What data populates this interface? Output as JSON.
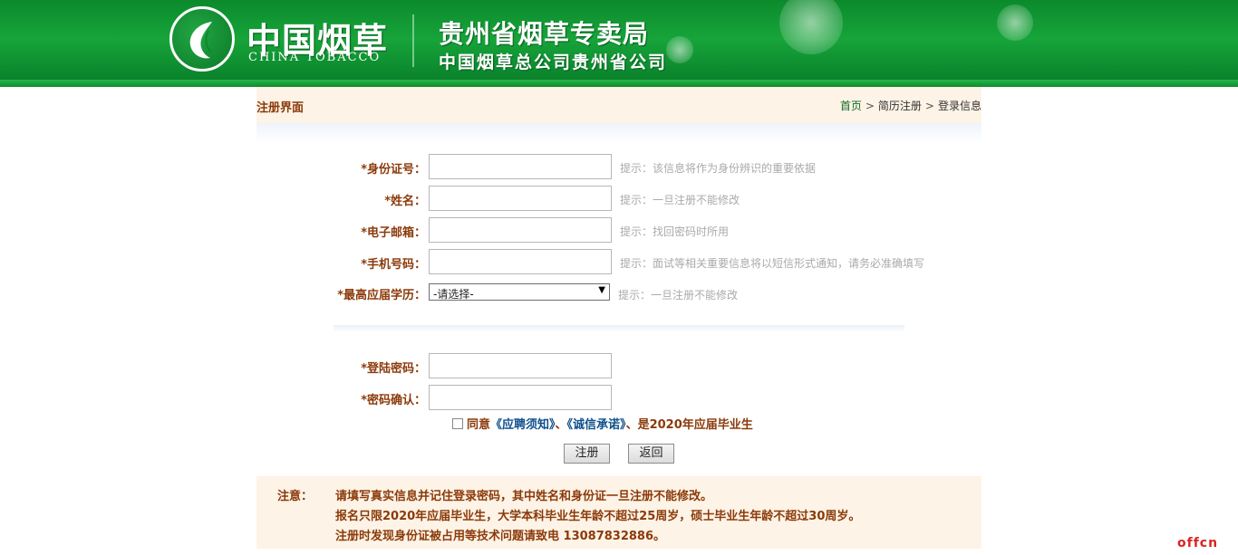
{
  "header": {
    "logo_cn": "中国烟草",
    "logo_en": "CHINA TOBACCO",
    "bureau_title": "贵州省烟草专卖局",
    "bureau_subtitle": "中国烟草总公司贵州省公司"
  },
  "page": {
    "title": "注册界面",
    "breadcrumb": [
      "首页",
      "简历注册",
      "登录信息"
    ],
    "breadcrumb_sep": ">"
  },
  "form": {
    "id_number": {
      "label": "*身份证号：",
      "value": "",
      "hint": "提示：该信息将作为身份辨识的重要依据"
    },
    "name": {
      "label": "*姓名：",
      "value": "",
      "hint": "提示：一旦注册不能修改"
    },
    "email": {
      "label": "*电子邮箱：",
      "value": "",
      "hint": "提示：找回密码时所用"
    },
    "phone": {
      "label": "*手机号码：",
      "value": "",
      "hint": "提示：面试等相关重要信息将以短信形式通知，请务必准确填写"
    },
    "education": {
      "label": "*最高应届学历：",
      "selected": "-请选择-",
      "hint": "提示：一旦注册不能修改"
    },
    "password": {
      "label": "*登陆密码：",
      "value": ""
    },
    "password_confirm": {
      "label": "*密码确认：",
      "value": ""
    }
  },
  "agreement": {
    "checked": false,
    "prefix": "同意",
    "link1": "《应聘须知》",
    "sep": "、",
    "link2": "《诚信承诺》",
    "suffix": "、是2020年应届毕业生"
  },
  "buttons": {
    "register": "注册",
    "back": "返回"
  },
  "notice": {
    "title": "注意：",
    "lines": [
      "请填写真实信息并记住登录密码，其中姓名和身份证一旦注册不能修改。",
      "报名只限2020年应届毕业生，大学本科毕业生年龄不超过25周岁，硕士毕业生年龄不超过30周岁。",
      "注册时发现身份证被占用等技术问题请致电 13087832886。"
    ]
  },
  "watermark": "offcn",
  "colors": {
    "brand_green": "#0b8a2c",
    "label_brown": "#8b3a0a",
    "hint_gray": "#aaaaaa",
    "notice_bg": "#fdf3e6"
  }
}
